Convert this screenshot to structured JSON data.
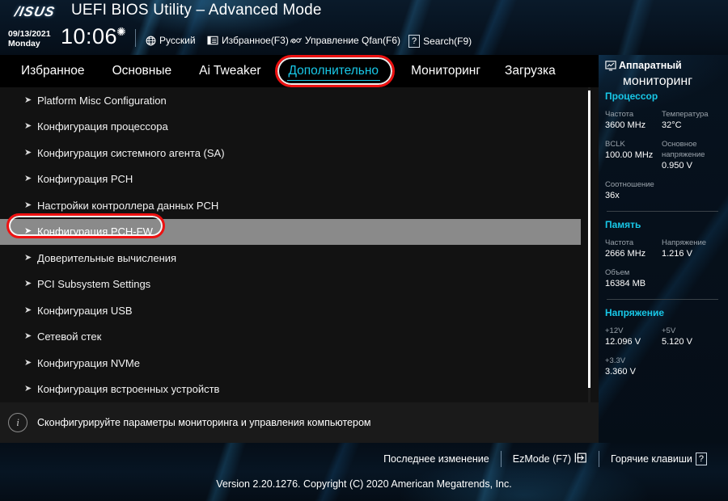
{
  "header": {
    "logo": "/ISUS",
    "title": "UEFI BIOS Utility – Advanced Mode",
    "date": "09/13/2021",
    "weekday": "Monday",
    "time": "10:06",
    "gear_icon": "gear-icon",
    "items": [
      {
        "icon": "globe-icon",
        "label": "Русский"
      },
      {
        "icon": "favorites-icon",
        "label": "Избранное(F3)"
      },
      {
        "icon": "qfan-icon",
        "label": "Управление Qfan(F6)"
      },
      {
        "icon": "question-icon",
        "label": "Search(F9)"
      }
    ]
  },
  "tabs": [
    {
      "label": "Избранное",
      "active": false
    },
    {
      "label": "Основные",
      "active": false
    },
    {
      "label": "Ai Tweaker",
      "active": false
    },
    {
      "label": "Дополнительно",
      "active": true
    },
    {
      "label": "Мониторинг",
      "active": false
    },
    {
      "label": "Загрузка",
      "active": false
    }
  ],
  "menu": {
    "items": [
      {
        "label": "Platform Misc Configuration",
        "selected": false
      },
      {
        "label": "Конфигурация процессора",
        "selected": false
      },
      {
        "label": "Конфигурация системного агента (SA)",
        "selected": false
      },
      {
        "label": "Конфигурация PCH",
        "selected": false
      },
      {
        "label": "Настройки контроллера данных PCH",
        "selected": false
      },
      {
        "label": "Конфигурация PCH-FW",
        "selected": true
      },
      {
        "label": "Доверительные вычисления",
        "selected": false
      },
      {
        "label": "PCI Subsystem Settings",
        "selected": false
      },
      {
        "label": "Конфигурация USB",
        "selected": false
      },
      {
        "label": "Сетевой стек",
        "selected": false
      },
      {
        "label": "Конфигурация NVMe",
        "selected": false
      },
      {
        "label": "Конфигурация встроенных устройств",
        "selected": false
      }
    ],
    "arrow_glyph": "➤"
  },
  "monitor": {
    "icon": "hardware-monitor-icon",
    "title_line1": "Аппаратный",
    "title_line2": "мониторинг",
    "cpu": {
      "section": "Процессор",
      "freq_label": "Частота",
      "freq_value": "3600 MHz",
      "temp_label": "Температура",
      "temp_value": "32°C",
      "bclk_label": "BCLK",
      "bclk_value": "100.00 MHz",
      "corev_label": "Основное напряжение",
      "corev_value": "0.950 V",
      "ratio_label": "Соотношение",
      "ratio_value": "36x"
    },
    "memory": {
      "section": "Память",
      "freq_label": "Частота",
      "freq_value": "2666 MHz",
      "volt_label": "Напряжение",
      "volt_value": "1.216 V",
      "size_label": "Объем",
      "size_value": "16384 MB"
    },
    "voltage": {
      "section": "Напряжение",
      "v12_label": "+12V",
      "v12_value": "12.096 V",
      "v5_label": "+5V",
      "v5_value": "5.120 V",
      "v33_label": "+3.3V",
      "v33_value": "3.360 V"
    }
  },
  "help": {
    "icon": "info-icon",
    "text": "Сконфигурируйте параметры мониторинга и управления компьютером"
  },
  "footer": {
    "last_modified": "Последнее изменение",
    "ezmode": "EzMode (F7)",
    "ezmode_icon": "exit-arrow-icon",
    "hotkeys": "Горячие клавиши",
    "hotkeys_icon": "?",
    "version": "Version 2.20.1276. Copyright (C) 2020 American Megatrends, Inc."
  },
  "colors": {
    "accent": "#18c8e8",
    "annotation": "#ee1111",
    "selected_row": "#8a8a8a",
    "menu_bg": "#121212"
  }
}
